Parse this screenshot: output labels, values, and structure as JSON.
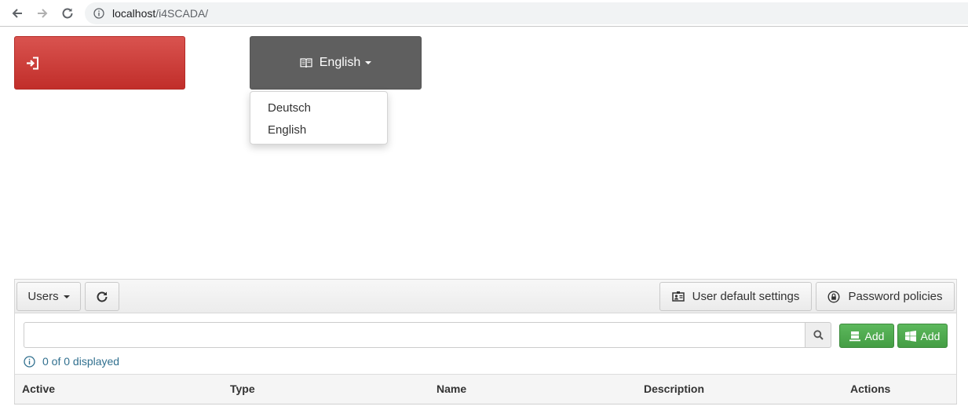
{
  "browser": {
    "url_host": "localhost",
    "url_path": "/i4SCADA/"
  },
  "header": {
    "language_button": "English",
    "language_options": [
      "Deutsch",
      "English"
    ]
  },
  "toolbar": {
    "users_dropdown": "Users",
    "user_default_settings": "User default settings",
    "password_policies": "Password policies"
  },
  "search": {
    "value": "",
    "add_user_label": "Add",
    "add_windows_user_label": "Add"
  },
  "status": {
    "count_text": "0 of 0 displayed"
  },
  "table": {
    "columns": [
      "Active",
      "Type",
      "Name",
      "Description",
      "Actions"
    ]
  },
  "colors": {
    "logout_red": "#d9534f",
    "language_gray": "#5f5f5f",
    "add_green": "#5cb85c",
    "info_blue": "#31708f"
  },
  "icons": {
    "logout": "sign-in-icon",
    "language": "book-icon",
    "refresh": "refresh-icon",
    "defaults": "id-card-icon",
    "password": "lock-icon",
    "search": "search-icon",
    "add_user": "server-icon",
    "add_windows": "windows-icon",
    "info": "info-icon"
  }
}
